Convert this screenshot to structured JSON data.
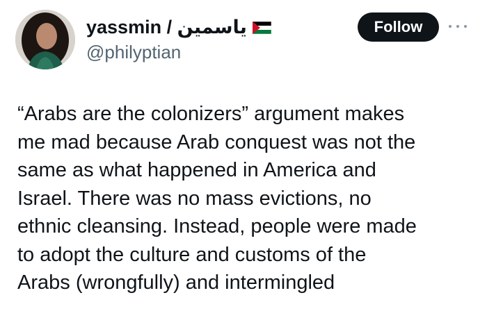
{
  "author": {
    "display_name": "yassmin / ياسمين",
    "flag_icon": "palestine-flag-icon",
    "handle": "@philyptian",
    "avatar_icon": "profile-photo"
  },
  "actions": {
    "follow_label": "Follow",
    "more_icon": "more-horizontal-icon"
  },
  "tweet": {
    "lines": [
      "“Arabs are the colonizers” argument makes",
      "me mad because Arab conquest was not the",
      "same as what happened in America and",
      "Israel. There was no mass evictions, no",
      "ethnic cleansing. Instead, people were made",
      "to adopt the culture and customs of the",
      "Arabs (wrongfully) and intermingled"
    ]
  },
  "colors": {
    "text": "#0f1419",
    "secondary_text": "#536471",
    "follow_bg": "#0f1419",
    "follow_text": "#ffffff",
    "flag_red": "#ce1126",
    "flag_green": "#007a3d",
    "flag_black": "#000000"
  }
}
